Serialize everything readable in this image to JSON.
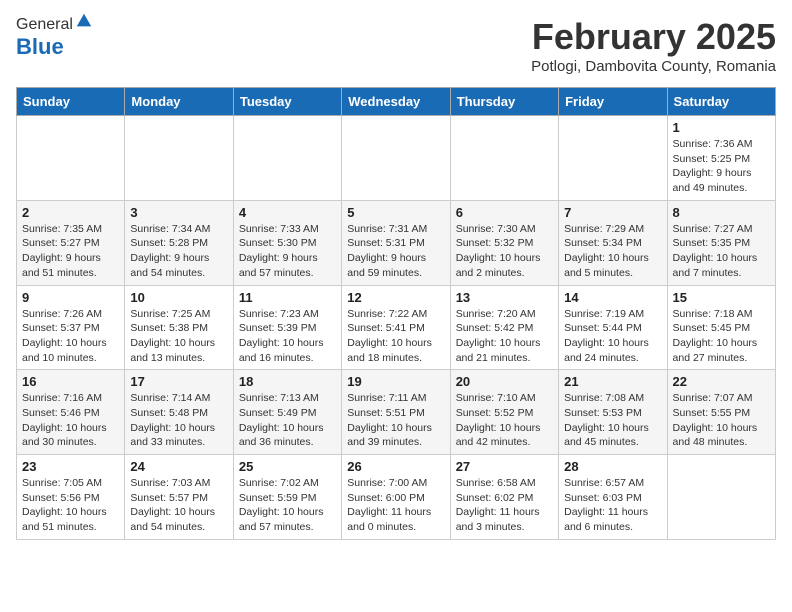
{
  "header": {
    "logo_general": "General",
    "logo_blue": "Blue",
    "month_year": "February 2025",
    "location": "Potlogi, Dambovita County, Romania"
  },
  "weekdays": [
    "Sunday",
    "Monday",
    "Tuesday",
    "Wednesday",
    "Thursday",
    "Friday",
    "Saturday"
  ],
  "weeks": [
    [
      {
        "num": "",
        "info": ""
      },
      {
        "num": "",
        "info": ""
      },
      {
        "num": "",
        "info": ""
      },
      {
        "num": "",
        "info": ""
      },
      {
        "num": "",
        "info": ""
      },
      {
        "num": "",
        "info": ""
      },
      {
        "num": "1",
        "info": "Sunrise: 7:36 AM\nSunset: 5:25 PM\nDaylight: 9 hours and 49 minutes."
      }
    ],
    [
      {
        "num": "2",
        "info": "Sunrise: 7:35 AM\nSunset: 5:27 PM\nDaylight: 9 hours and 51 minutes."
      },
      {
        "num": "3",
        "info": "Sunrise: 7:34 AM\nSunset: 5:28 PM\nDaylight: 9 hours and 54 minutes."
      },
      {
        "num": "4",
        "info": "Sunrise: 7:33 AM\nSunset: 5:30 PM\nDaylight: 9 hours and 57 minutes."
      },
      {
        "num": "5",
        "info": "Sunrise: 7:31 AM\nSunset: 5:31 PM\nDaylight: 9 hours and 59 minutes."
      },
      {
        "num": "6",
        "info": "Sunrise: 7:30 AM\nSunset: 5:32 PM\nDaylight: 10 hours and 2 minutes."
      },
      {
        "num": "7",
        "info": "Sunrise: 7:29 AM\nSunset: 5:34 PM\nDaylight: 10 hours and 5 minutes."
      },
      {
        "num": "8",
        "info": "Sunrise: 7:27 AM\nSunset: 5:35 PM\nDaylight: 10 hours and 7 minutes."
      }
    ],
    [
      {
        "num": "9",
        "info": "Sunrise: 7:26 AM\nSunset: 5:37 PM\nDaylight: 10 hours and 10 minutes."
      },
      {
        "num": "10",
        "info": "Sunrise: 7:25 AM\nSunset: 5:38 PM\nDaylight: 10 hours and 13 minutes."
      },
      {
        "num": "11",
        "info": "Sunrise: 7:23 AM\nSunset: 5:39 PM\nDaylight: 10 hours and 16 minutes."
      },
      {
        "num": "12",
        "info": "Sunrise: 7:22 AM\nSunset: 5:41 PM\nDaylight: 10 hours and 18 minutes."
      },
      {
        "num": "13",
        "info": "Sunrise: 7:20 AM\nSunset: 5:42 PM\nDaylight: 10 hours and 21 minutes."
      },
      {
        "num": "14",
        "info": "Sunrise: 7:19 AM\nSunset: 5:44 PM\nDaylight: 10 hours and 24 minutes."
      },
      {
        "num": "15",
        "info": "Sunrise: 7:18 AM\nSunset: 5:45 PM\nDaylight: 10 hours and 27 minutes."
      }
    ],
    [
      {
        "num": "16",
        "info": "Sunrise: 7:16 AM\nSunset: 5:46 PM\nDaylight: 10 hours and 30 minutes."
      },
      {
        "num": "17",
        "info": "Sunrise: 7:14 AM\nSunset: 5:48 PM\nDaylight: 10 hours and 33 minutes."
      },
      {
        "num": "18",
        "info": "Sunrise: 7:13 AM\nSunset: 5:49 PM\nDaylight: 10 hours and 36 minutes."
      },
      {
        "num": "19",
        "info": "Sunrise: 7:11 AM\nSunset: 5:51 PM\nDaylight: 10 hours and 39 minutes."
      },
      {
        "num": "20",
        "info": "Sunrise: 7:10 AM\nSunset: 5:52 PM\nDaylight: 10 hours and 42 minutes."
      },
      {
        "num": "21",
        "info": "Sunrise: 7:08 AM\nSunset: 5:53 PM\nDaylight: 10 hours and 45 minutes."
      },
      {
        "num": "22",
        "info": "Sunrise: 7:07 AM\nSunset: 5:55 PM\nDaylight: 10 hours and 48 minutes."
      }
    ],
    [
      {
        "num": "23",
        "info": "Sunrise: 7:05 AM\nSunset: 5:56 PM\nDaylight: 10 hours and 51 minutes."
      },
      {
        "num": "24",
        "info": "Sunrise: 7:03 AM\nSunset: 5:57 PM\nDaylight: 10 hours and 54 minutes."
      },
      {
        "num": "25",
        "info": "Sunrise: 7:02 AM\nSunset: 5:59 PM\nDaylight: 10 hours and 57 minutes."
      },
      {
        "num": "26",
        "info": "Sunrise: 7:00 AM\nSunset: 6:00 PM\nDaylight: 11 hours and 0 minutes."
      },
      {
        "num": "27",
        "info": "Sunrise: 6:58 AM\nSunset: 6:02 PM\nDaylight: 11 hours and 3 minutes."
      },
      {
        "num": "28",
        "info": "Sunrise: 6:57 AM\nSunset: 6:03 PM\nDaylight: 11 hours and 6 minutes."
      },
      {
        "num": "",
        "info": ""
      }
    ]
  ]
}
